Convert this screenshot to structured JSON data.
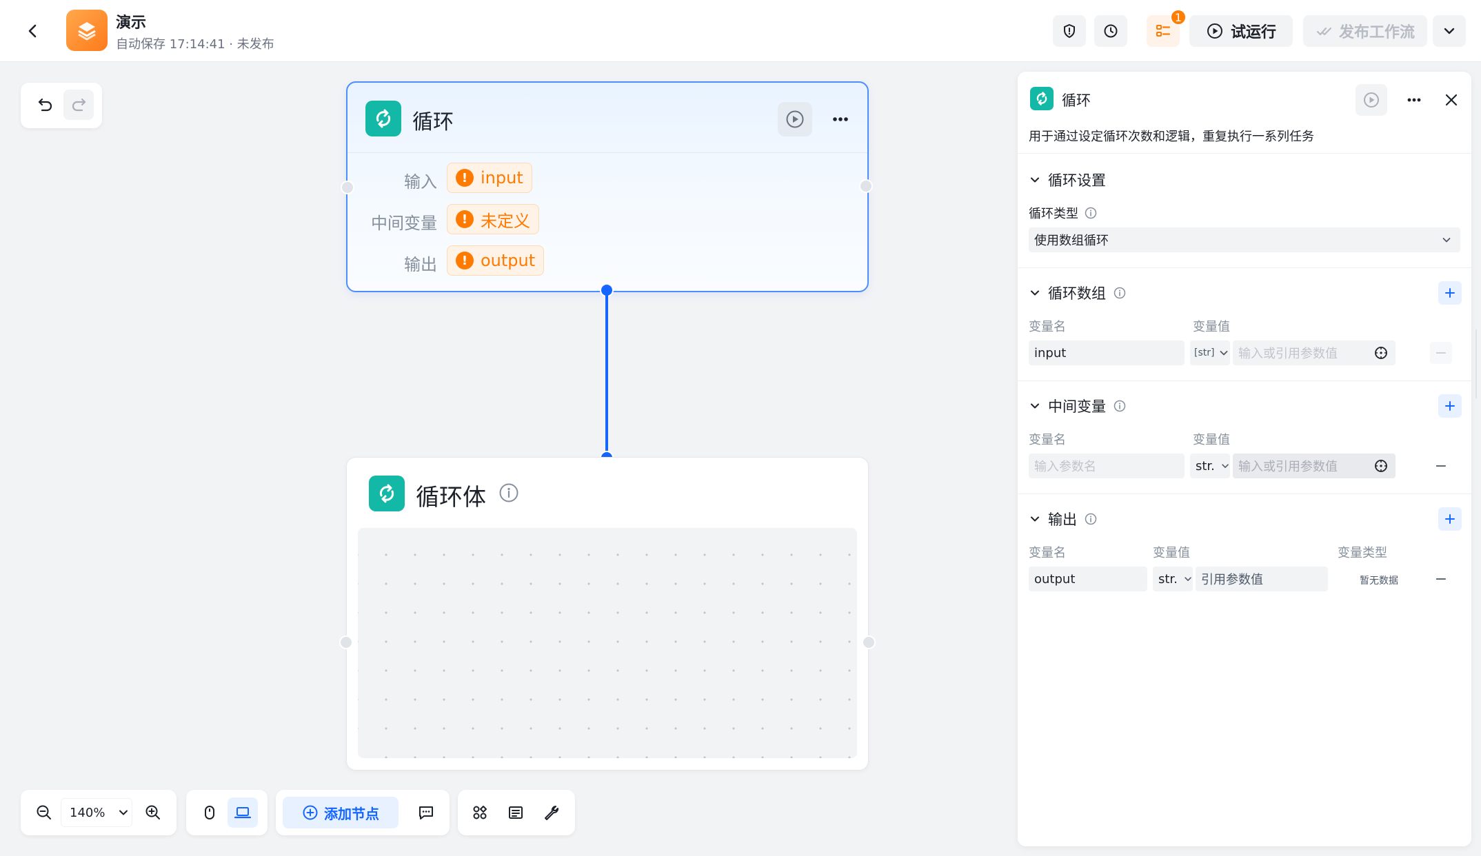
{
  "app": {
    "title": "演示",
    "subtitle": "自动保存 17:14:41 · 未发布"
  },
  "toolbar": {
    "badge_count": "1",
    "try_run": "试运行",
    "publish": "发布工作流"
  },
  "loop_node": {
    "title": "循环",
    "rows": [
      {
        "label": "输入",
        "value": "input"
      },
      {
        "label": "中间变量",
        "value": "未定义"
      },
      {
        "label": "输出",
        "value": "output"
      }
    ],
    "warn_glyph": "!"
  },
  "body_node": {
    "title": "循环体"
  },
  "bottom": {
    "zoom": "140%",
    "add_node": "添加节点"
  },
  "panel": {
    "title": "循环",
    "description": "用于通过设定循环次数和逻辑，重复执行一系列任务",
    "loop_settings": {
      "title": "循环设置",
      "type_label": "循环类型",
      "type_value": "使用数组循环"
    },
    "loop_array": {
      "title": "循环数组",
      "col_name": "变量名",
      "col_value": "变量值",
      "row": {
        "name": "input",
        "type": "[str]",
        "value_placeholder": "输入或引用参数值"
      },
      "minus": "−"
    },
    "middle_vars": {
      "title": "中间变量",
      "col_name": "变量名",
      "col_value": "变量值",
      "row": {
        "name_placeholder": "输入参数名",
        "type": "str.",
        "value_placeholder": "输入或引用参数值"
      },
      "minus": "−"
    },
    "output": {
      "title": "输出",
      "col_name": "变量名",
      "col_value": "变量值",
      "col_type": "变量类型",
      "row": {
        "name": "output",
        "type": "str.",
        "value": "引用参数值",
        "var_type": "暂无数据"
      },
      "minus": "−"
    }
  },
  "colors": {
    "accent": "#1466ff",
    "loop_icon": "#14b8a6",
    "warning": "#ff7a00"
  }
}
